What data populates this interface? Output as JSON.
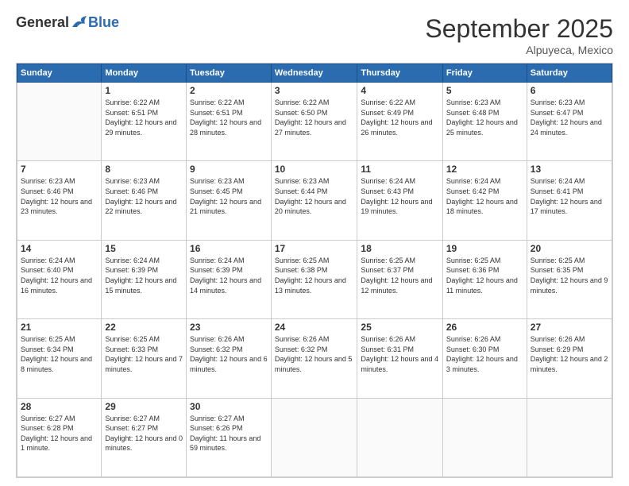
{
  "header": {
    "logo": {
      "general": "General",
      "blue": "Blue"
    },
    "title": "September 2025",
    "location": "Alpuyeca, Mexico"
  },
  "days_of_week": [
    "Sunday",
    "Monday",
    "Tuesday",
    "Wednesday",
    "Thursday",
    "Friday",
    "Saturday"
  ],
  "weeks": [
    [
      {
        "day": "",
        "empty": true
      },
      {
        "day": "1",
        "sunrise": "Sunrise: 6:22 AM",
        "sunset": "Sunset: 6:51 PM",
        "daylight": "Daylight: 12 hours and 29 minutes."
      },
      {
        "day": "2",
        "sunrise": "Sunrise: 6:22 AM",
        "sunset": "Sunset: 6:51 PM",
        "daylight": "Daylight: 12 hours and 28 minutes."
      },
      {
        "day": "3",
        "sunrise": "Sunrise: 6:22 AM",
        "sunset": "Sunset: 6:50 PM",
        "daylight": "Daylight: 12 hours and 27 minutes."
      },
      {
        "day": "4",
        "sunrise": "Sunrise: 6:22 AM",
        "sunset": "Sunset: 6:49 PM",
        "daylight": "Daylight: 12 hours and 26 minutes."
      },
      {
        "day": "5",
        "sunrise": "Sunrise: 6:23 AM",
        "sunset": "Sunset: 6:48 PM",
        "daylight": "Daylight: 12 hours and 25 minutes."
      },
      {
        "day": "6",
        "sunrise": "Sunrise: 6:23 AM",
        "sunset": "Sunset: 6:47 PM",
        "daylight": "Daylight: 12 hours and 24 minutes."
      }
    ],
    [
      {
        "day": "7",
        "sunrise": "Sunrise: 6:23 AM",
        "sunset": "Sunset: 6:46 PM",
        "daylight": "Daylight: 12 hours and 23 minutes."
      },
      {
        "day": "8",
        "sunrise": "Sunrise: 6:23 AM",
        "sunset": "Sunset: 6:46 PM",
        "daylight": "Daylight: 12 hours and 22 minutes."
      },
      {
        "day": "9",
        "sunrise": "Sunrise: 6:23 AM",
        "sunset": "Sunset: 6:45 PM",
        "daylight": "Daylight: 12 hours and 21 minutes."
      },
      {
        "day": "10",
        "sunrise": "Sunrise: 6:23 AM",
        "sunset": "Sunset: 6:44 PM",
        "daylight": "Daylight: 12 hours and 20 minutes."
      },
      {
        "day": "11",
        "sunrise": "Sunrise: 6:24 AM",
        "sunset": "Sunset: 6:43 PM",
        "daylight": "Daylight: 12 hours and 19 minutes."
      },
      {
        "day": "12",
        "sunrise": "Sunrise: 6:24 AM",
        "sunset": "Sunset: 6:42 PM",
        "daylight": "Daylight: 12 hours and 18 minutes."
      },
      {
        "day": "13",
        "sunrise": "Sunrise: 6:24 AM",
        "sunset": "Sunset: 6:41 PM",
        "daylight": "Daylight: 12 hours and 17 minutes."
      }
    ],
    [
      {
        "day": "14",
        "sunrise": "Sunrise: 6:24 AM",
        "sunset": "Sunset: 6:40 PM",
        "daylight": "Daylight: 12 hours and 16 minutes."
      },
      {
        "day": "15",
        "sunrise": "Sunrise: 6:24 AM",
        "sunset": "Sunset: 6:39 PM",
        "daylight": "Daylight: 12 hours and 15 minutes."
      },
      {
        "day": "16",
        "sunrise": "Sunrise: 6:24 AM",
        "sunset": "Sunset: 6:39 PM",
        "daylight": "Daylight: 12 hours and 14 minutes."
      },
      {
        "day": "17",
        "sunrise": "Sunrise: 6:25 AM",
        "sunset": "Sunset: 6:38 PM",
        "daylight": "Daylight: 12 hours and 13 minutes."
      },
      {
        "day": "18",
        "sunrise": "Sunrise: 6:25 AM",
        "sunset": "Sunset: 6:37 PM",
        "daylight": "Daylight: 12 hours and 12 minutes."
      },
      {
        "day": "19",
        "sunrise": "Sunrise: 6:25 AM",
        "sunset": "Sunset: 6:36 PM",
        "daylight": "Daylight: 12 hours and 11 minutes."
      },
      {
        "day": "20",
        "sunrise": "Sunrise: 6:25 AM",
        "sunset": "Sunset: 6:35 PM",
        "daylight": "Daylight: 12 hours and 9 minutes."
      }
    ],
    [
      {
        "day": "21",
        "sunrise": "Sunrise: 6:25 AM",
        "sunset": "Sunset: 6:34 PM",
        "daylight": "Daylight: 12 hours and 8 minutes."
      },
      {
        "day": "22",
        "sunrise": "Sunrise: 6:25 AM",
        "sunset": "Sunset: 6:33 PM",
        "daylight": "Daylight: 12 hours and 7 minutes."
      },
      {
        "day": "23",
        "sunrise": "Sunrise: 6:26 AM",
        "sunset": "Sunset: 6:32 PM",
        "daylight": "Daylight: 12 hours and 6 minutes."
      },
      {
        "day": "24",
        "sunrise": "Sunrise: 6:26 AM",
        "sunset": "Sunset: 6:32 PM",
        "daylight": "Daylight: 12 hours and 5 minutes."
      },
      {
        "day": "25",
        "sunrise": "Sunrise: 6:26 AM",
        "sunset": "Sunset: 6:31 PM",
        "daylight": "Daylight: 12 hours and 4 minutes."
      },
      {
        "day": "26",
        "sunrise": "Sunrise: 6:26 AM",
        "sunset": "Sunset: 6:30 PM",
        "daylight": "Daylight: 12 hours and 3 minutes."
      },
      {
        "day": "27",
        "sunrise": "Sunrise: 6:26 AM",
        "sunset": "Sunset: 6:29 PM",
        "daylight": "Daylight: 12 hours and 2 minutes."
      }
    ],
    [
      {
        "day": "28",
        "sunrise": "Sunrise: 6:27 AM",
        "sunset": "Sunset: 6:28 PM",
        "daylight": "Daylight: 12 hours and 1 minute."
      },
      {
        "day": "29",
        "sunrise": "Sunrise: 6:27 AM",
        "sunset": "Sunset: 6:27 PM",
        "daylight": "Daylight: 12 hours and 0 minutes."
      },
      {
        "day": "30",
        "sunrise": "Sunrise: 6:27 AM",
        "sunset": "Sunset: 6:26 PM",
        "daylight": "Daylight: 11 hours and 59 minutes."
      },
      {
        "day": "",
        "empty": true
      },
      {
        "day": "",
        "empty": true
      },
      {
        "day": "",
        "empty": true
      },
      {
        "day": "",
        "empty": true
      }
    ]
  ]
}
